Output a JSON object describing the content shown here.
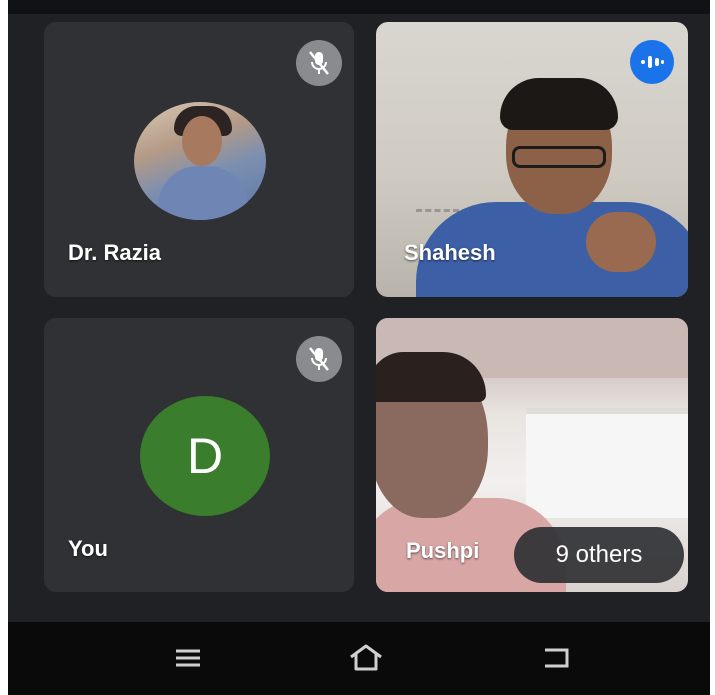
{
  "participants": [
    {
      "name": "Dr. Razia",
      "status": "muted"
    },
    {
      "name": "Shahesh",
      "status": "speaking"
    },
    {
      "name": "You",
      "status": "muted",
      "initial": "D"
    },
    {
      "name": "Pushpi",
      "status": "video"
    }
  ],
  "others": {
    "label": "9 others"
  },
  "colors": {
    "background": "#202124",
    "tile": "#303134",
    "avatar_green": "#3a7d2c",
    "speaking_blue": "#1a73e8",
    "muted_gray": "#8a8b8e"
  },
  "icons": {
    "muted": "mic-off-icon",
    "speaking": "audio-wave-icon",
    "nav": [
      "menu-icon",
      "home-icon",
      "back-icon"
    ]
  }
}
